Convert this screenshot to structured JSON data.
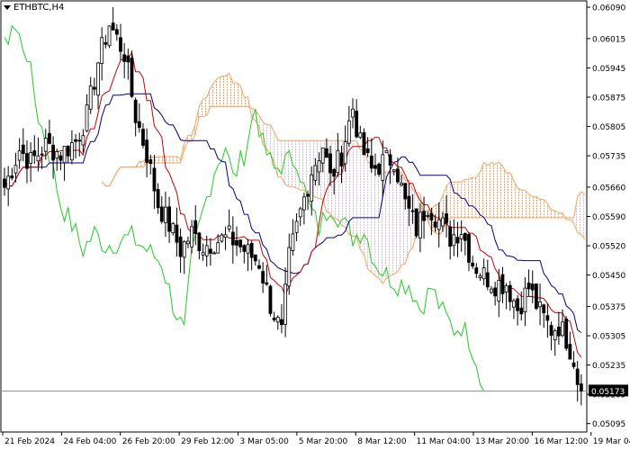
{
  "chart_data": {
    "type": "candlestick",
    "symbol_title": "ETHBTC,H4",
    "current_price": "0.05173",
    "y_tick_labels": [
      "0.06090",
      "0.06015",
      "0.05945",
      "0.05875",
      "0.05805",
      "0.05735",
      "0.05660",
      "0.05590",
      "0.05520",
      "0.05450",
      "0.05375",
      "0.05305",
      "0.05235",
      "0.05165",
      "0.05095"
    ],
    "y_tick_values": [
      0.0609,
      0.06015,
      0.05945,
      0.05875,
      0.05805,
      0.05735,
      0.0566,
      0.0559,
      0.0552,
      0.0545,
      0.05375,
      0.05305,
      0.05235,
      0.05165,
      0.05095
    ],
    "ylim": [
      0.05075,
      0.06105
    ],
    "x_tick_labels": [
      "21 Feb 2024",
      "24 Feb 04:00",
      "26 Feb 20:00",
      "29 Feb 12:00",
      "3 Mar 05:00",
      "5 Mar 20:00",
      "8 Mar 12:00",
      "11 Mar 04:00",
      "13 Mar 20:00",
      "16 Mar 12:00",
      "19 Mar 04:00"
    ],
    "indicators": [
      "Tenkan-sen",
      "Kijun-sen",
      "Chikou Span",
      "Senkou Span A",
      "Senkou Span B"
    ],
    "colors": {
      "tenkan": "#cc0000",
      "kijun": "#00008b",
      "chikou": "#22cc22",
      "cloud_bull": "#f4a460",
      "cloud_bear": "#d8bfd8",
      "candle": "#000000",
      "grid_line": "#888888"
    },
    "anchors": [
      [
        0,
        0.0566
      ],
      [
        4,
        0.0575
      ],
      [
        7,
        0.0572
      ],
      [
        11,
        0.0576
      ],
      [
        15,
        0.0574
      ],
      [
        19,
        0.0577
      ],
      [
        22,
        0.0583
      ],
      [
        25,
        0.0596
      ],
      [
        28,
        0.0605
      ],
      [
        32,
        0.0598
      ],
      [
        35,
        0.0583
      ],
      [
        38,
        0.0574
      ],
      [
        41,
        0.0562
      ],
      [
        44,
        0.0557
      ],
      [
        47,
        0.0551
      ],
      [
        50,
        0.0555
      ],
      [
        53,
        0.0552
      ],
      [
        56,
        0.0553
      ],
      [
        60,
        0.0554
      ],
      [
        64,
        0.0551
      ],
      [
        68,
        0.0548
      ],
      [
        71,
        0.0538
      ],
      [
        74,
        0.0531
      ],
      [
        76,
        0.0549
      ],
      [
        79,
        0.056
      ],
      [
        82,
        0.057
      ],
      [
        85,
        0.0576
      ],
      [
        87,
        0.0568
      ],
      [
        90,
        0.0574
      ],
      [
        93,
        0.0585
      ],
      [
        95,
        0.0576
      ],
      [
        98,
        0.057
      ],
      [
        101,
        0.0572
      ],
      [
        104,
        0.0573
      ],
      [
        107,
        0.0562
      ],
      [
        110,
        0.0556
      ],
      [
        113,
        0.0562
      ],
      [
        116,
        0.0558
      ],
      [
        119,
        0.0554
      ],
      [
        122,
        0.0556
      ],
      [
        125,
        0.0548
      ],
      [
        128,
        0.0545
      ],
      [
        131,
        0.0543
      ],
      [
        134,
        0.0543
      ],
      [
        137,
        0.0537
      ],
      [
        140,
        0.0542
      ],
      [
        143,
        0.0536
      ],
      [
        146,
        0.0532
      ],
      [
        148,
        0.0533
      ],
      [
        150,
        0.053
      ],
      [
        152,
        0.0525
      ],
      [
        154,
        0.0515
      ]
    ]
  }
}
